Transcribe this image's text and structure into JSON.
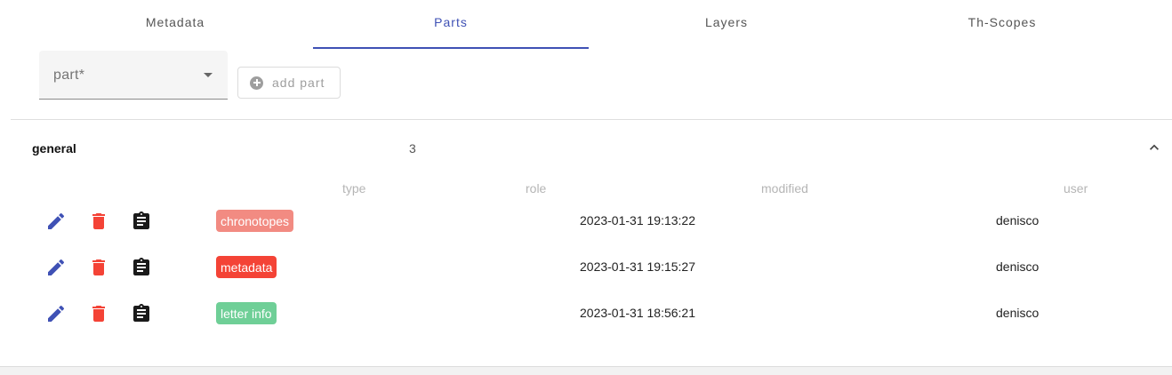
{
  "tabs": [
    {
      "label": "Metadata",
      "active": false
    },
    {
      "label": "Parts",
      "active": true
    },
    {
      "label": "Layers",
      "active": false
    },
    {
      "label": "Th-Scopes",
      "active": false
    }
  ],
  "part_select": {
    "label": "part*"
  },
  "add_part": {
    "label": "add part",
    "icon": "add-circle-icon"
  },
  "group": {
    "title": "general",
    "count": "3"
  },
  "columns": [
    "type",
    "role",
    "modified",
    "user"
  ],
  "rows": [
    {
      "type": "chronotopes",
      "type_color": "#f28b82",
      "role": "",
      "modified": "2023-01-31 19:13:22",
      "user": "denisco"
    },
    {
      "type": "metadata",
      "type_color": "#f44336",
      "role": "",
      "modified": "2023-01-31 19:15:27",
      "user": "denisco"
    },
    {
      "type": "letter info",
      "type_color": "#6fcf97",
      "role": "",
      "modified": "2023-01-31 18:56:21",
      "user": "denisco"
    }
  ],
  "colors": {
    "accent": "#3f51b5",
    "delete": "#f44336"
  }
}
